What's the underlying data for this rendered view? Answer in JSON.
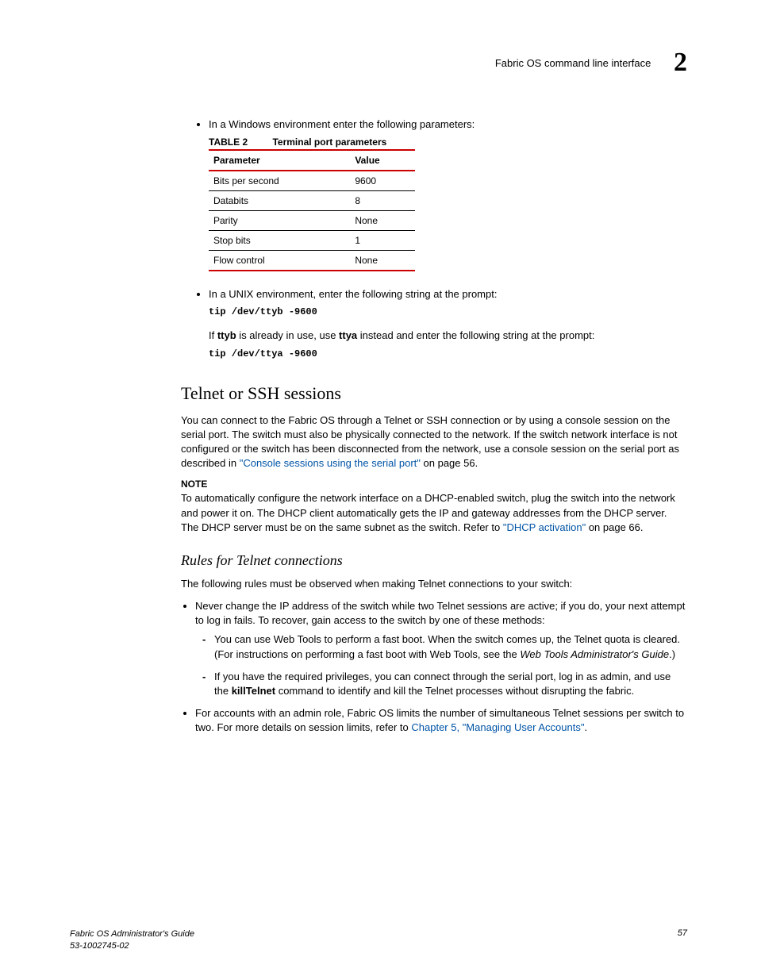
{
  "header": {
    "title": "Fabric OS command line interface",
    "chapter": "2"
  },
  "bullet1": "In a Windows environment enter the following parameters:",
  "table": {
    "label": "TABLE 2",
    "title": "Terminal port parameters",
    "headers": {
      "col1": "Parameter",
      "col2": "Value"
    },
    "rows": [
      {
        "p": "Bits per second",
        "v": "9600"
      },
      {
        "p": "Databits",
        "v": "8"
      },
      {
        "p": "Parity",
        "v": "None"
      },
      {
        "p": "Stop bits",
        "v": "1"
      },
      {
        "p": "Flow control",
        "v": "None"
      }
    ]
  },
  "bullet2": "In a UNIX environment, enter the following string at the prompt:",
  "code1": "tip /dev/ttyb -9600",
  "ttyb_text_a": "If ",
  "ttyb_bold": "ttyb",
  "ttyb_text_b": " is already in use, use ",
  "ttya_bold": "ttya",
  "ttyb_text_c": "  instead and enter the following string at the prompt:",
  "code2": "tip /dev/ttya -9600",
  "section2": {
    "title": "Telnet or SSH sessions",
    "p1_a": "You can connect to the Fabric OS through a Telnet or SSH connection or by using a console session on the serial port. The switch must also be physically connected to the network. If the switch network interface is not configured or the switch has been disconnected from the network, use a console session on the serial port as described in ",
    "p1_link": "\"Console sessions using the serial port\"",
    "p1_b": " on page 56.",
    "note_label": "NOTE",
    "note_a": "To automatically configure the network interface on a DHCP-enabled switch, plug the switch into the network and power it on. The DHCP client automatically gets the IP and gateway addresses from the DHCP server. The DHCP server must be on the same subnet as the switch. Refer to ",
    "note_link": "\"DHCP activation\"",
    "note_b": " on page 66."
  },
  "section3": {
    "title": "Rules for Telnet connections",
    "intro": "The following rules must be observed when making Telnet connections to your switch:",
    "b1": "Never change the IP address of the switch while two Telnet sessions are active; if you do, your next attempt to log in fails. To recover, gain access to the switch by one of these methods:",
    "b1_s1_a": "You can use Web Tools to perform a fast boot. When the switch comes up, the Telnet quota is cleared. (For instructions on performing a fast boot with Web Tools, see the ",
    "b1_s1_italic": "Web Tools Administrator's Guide",
    "b1_s1_b": ".)",
    "b1_s2_a": "If you have the required privileges, you can connect through the serial port, log in as admin, and use the ",
    "b1_s2_bold": "killTelnet",
    "b1_s2_b": " command to identify and kill the Telnet processes without disrupting the fabric.",
    "b2_a": "For accounts with an admin role, Fabric OS limits the number of simultaneous Telnet sessions per switch to two. For more details on session limits, refer to ",
    "b2_link": "Chapter 5, \"Managing User Accounts\"",
    "b2_b": "."
  },
  "footer": {
    "guide": "Fabric OS Administrator's Guide",
    "docnum": "53-1002745-02",
    "page": "57"
  }
}
